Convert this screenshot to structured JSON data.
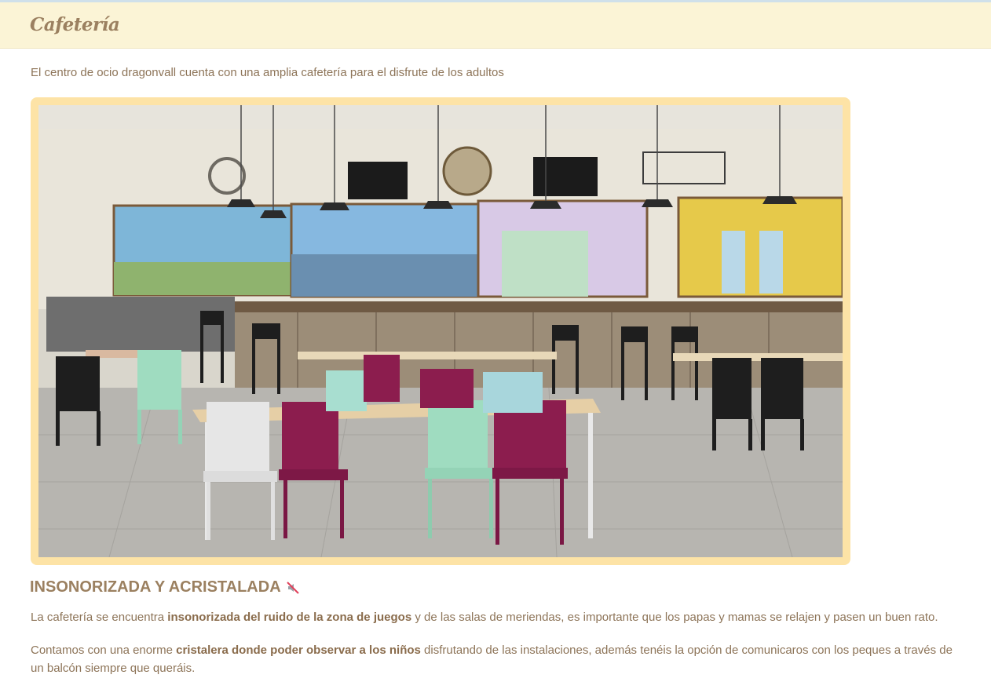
{
  "header": {
    "title": "Cafetería"
  },
  "intro": {
    "text": "El centro de ocio dragonvall cuenta con una amplia cafetería para el disfrute de los adultos"
  },
  "photo": {
    "icon": "cafeteria-photo",
    "frame_color": "#fde3a6"
  },
  "section": {
    "heading": "INSONORIZADA Y ACRISTALADA",
    "heading_icon": "no-sound-icon"
  },
  "paragraphs": {
    "p1_a": "La cafetería se encuentra ",
    "p1_b": "insonorizada del ruido de la zona de juegos",
    "p1_c": " y de las salas de meriendas, es importante que los papas y mamas se relajen y pasen un buen rato.",
    "p2_a": "Contamos con una enorme ",
    "p2_b": "cristalera donde poder observar a los niños",
    "p2_c": " disfrutando de las instalaciones, además tenéis la opción de comunicaros con los peques a través de un balcón siempre que queráis."
  },
  "colors": {
    "header_bg": "#fbf4d6",
    "title": "#9b8060",
    "text": "#8d7458"
  }
}
